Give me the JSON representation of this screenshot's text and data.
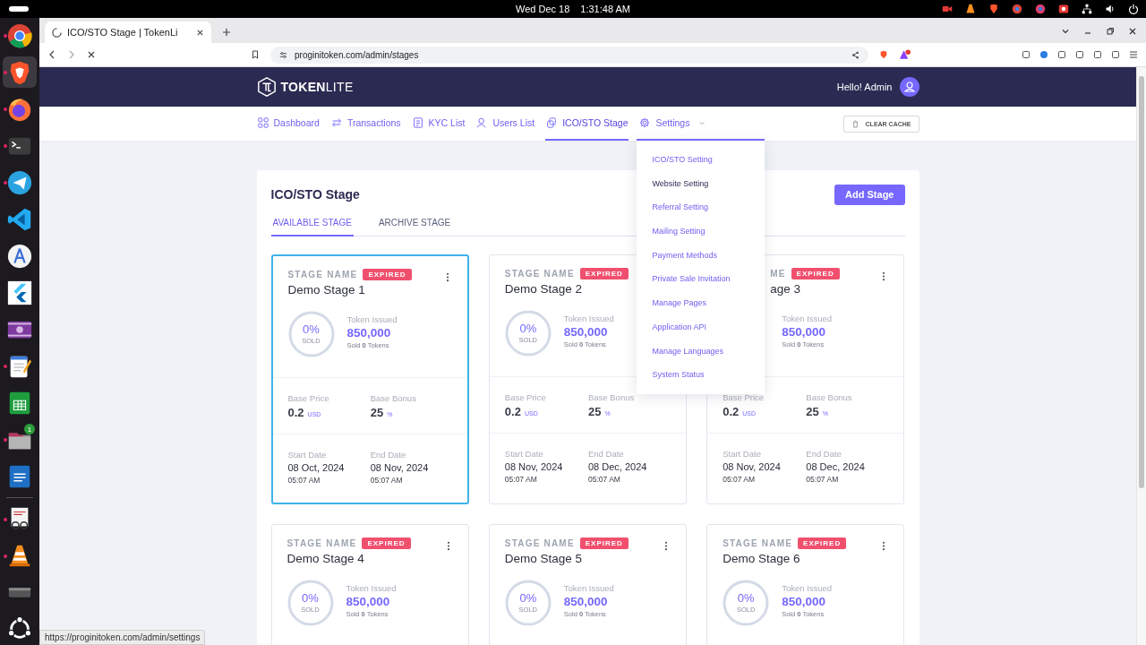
{
  "system_bar": {
    "date": "Wed Dec 18",
    "time": "1:31:48 AM"
  },
  "dock": [
    {
      "kind": "globe",
      "running": true,
      "selected": false
    },
    {
      "kind": "lion",
      "running": true,
      "selected": true
    },
    {
      "kind": "fox",
      "running": true,
      "selected": false
    },
    {
      "kind": "terminal",
      "running": true,
      "selected": false
    },
    {
      "kind": "plane",
      "running": true,
      "selected": false
    },
    {
      "kind": "code",
      "running": false,
      "selected": false
    },
    {
      "kind": "compass",
      "running": false,
      "selected": false
    },
    {
      "kind": "wing",
      "running": false,
      "selected": false
    },
    {
      "kind": "film",
      "running": false,
      "selected": false
    },
    {
      "kind": "notepad",
      "running": true,
      "selected": false
    },
    {
      "kind": "sheet",
      "running": false,
      "selected": false
    },
    {
      "kind": "folder",
      "running": true,
      "selected": false,
      "badge": "1"
    },
    {
      "kind": "doc",
      "running": false,
      "selected": false
    },
    {
      "kind": "reader",
      "running": true,
      "selected": false
    },
    {
      "kind": "cone",
      "running": true,
      "selected": false
    },
    {
      "kind": "drive",
      "running": false,
      "selected": false
    },
    {
      "kind": "spiral",
      "running": false,
      "selected": false
    }
  ],
  "browser": {
    "tabs": [
      {
        "title": "ICO/STO Stage | TokenLi",
        "selected": true,
        "loading": true
      }
    ],
    "address": "proginitoken.com/admin/stages",
    "status_url": "https://proginitoken.com/admin/settings"
  },
  "header": {
    "logo": "**TOKEN**LITE",
    "greeting": "Hello! Admin"
  },
  "nav": [
    {
      "label": "Dashboard",
      "selected": false
    },
    {
      "label": "Transactions",
      "selected": false
    },
    {
      "label": "KYC List",
      "selected": false
    },
    {
      "label": "Users List",
      "selected": false
    },
    {
      "label": "ICO/STO Stage",
      "selected": true
    },
    {
      "label": "Settings",
      "selected": false,
      "expanded": true,
      "menu": [
        {
          "label": "ICO/STO Setting",
          "hovered": false
        },
        {
          "label": "Website Setting",
          "hovered": true
        },
        {
          "label": "Referral Setting",
          "hovered": false
        },
        {
          "label": "Mailing Setting",
          "hovered": false
        },
        {
          "label": "Payment Methods",
          "hovered": false
        },
        {
          "label": "Private Sale Invitation",
          "hovered": false
        },
        {
          "label": "Manage Pages",
          "hovered": false
        },
        {
          "label": "Application API",
          "hovered": false
        },
        {
          "label": "Manage Languages",
          "hovered": false
        },
        {
          "label": "System Status",
          "hovered": false
        }
      ]
    }
  ],
  "clear_cache": "CLEAR CACHE",
  "panel": {
    "title": "ICO/STO Stage",
    "add_button": "Add Stage",
    "tabs": [
      {
        "label": "AVAILABLE STAGE",
        "selected": true
      },
      {
        "label": "ARCHIVE STAGE",
        "selected": false
      }
    ],
    "cards": [
      {
        "label": "STAGE NAME",
        "status": "EXPIRED",
        "name": "Demo Stage 1",
        "selected": true,
        "menu": true,
        "percent": "0%",
        "sold_label": "SOLD",
        "issued_label": "Token Issued",
        "issued": "850,000",
        "sold_tokens": "Sold **0** Tokens",
        "price_label": "Base Price",
        "price": "0.2",
        "price_unit": "USD",
        "bonus_label": "Base Bonus",
        "bonus": "25",
        "bonus_unit": "%",
        "start_label": "Start Date",
        "start_date": "08 Oct, 2024",
        "start_time": "05:07 AM",
        "end_label": "End Date",
        "end_date": "08 Nov, 2024",
        "end_time": "05:07 AM"
      },
      {
        "label": "STAGE NAME",
        "status": "EXPIRED",
        "name": "Demo Stage 2",
        "selected": false,
        "percent": "0%",
        "sold_label": "SOLD",
        "issued_label": "Token Issued",
        "issued": "850,000",
        "sold_tokens": "Sold **0** Tokens",
        "price_label": "Base Price",
        "price": "0.2",
        "price_unit": "USD",
        "bonus_label": "Base Bonus",
        "bonus": "25",
        "bonus_unit": "%",
        "start_label": "Start Date",
        "start_date": "08 Nov, 2024",
        "start_time": "05:07 AM",
        "end_label": "End Date",
        "end_date": "08 Dec, 2024",
        "end_time": "05:07 AM"
      },
      {
        "label": "ME",
        "covered": true,
        "status": "EXPIRED",
        "name": "age 3",
        "selected": false,
        "menu": true,
        "issued_label": "Token Issued",
        "issued": "850,000",
        "sold_tokens": "Sold **0** Tokens",
        "price_label": "Base Price",
        "price": "0.2",
        "price_unit": "USD",
        "bonus_label": "Base Bonus",
        "bonus": "25",
        "bonus_unit": "%",
        "start_label": "Start Date",
        "start_date": "08 Nov, 2024",
        "start_time": "05:07 AM",
        "end_label": "End Date",
        "end_date": "08 Dec, 2024",
        "end_time": "05:07 AM"
      },
      {
        "label": "STAGE NAME",
        "status": "EXPIRED",
        "name": "Demo Stage 4",
        "selected": false,
        "menu": true,
        "percent": "0%",
        "sold_label": "SOLD",
        "issued_label": "Token Issued",
        "issued": "850,000",
        "sold_tokens": "Sold **0** Tokens"
      },
      {
        "label": "STAGE NAME",
        "status": "EXPIRED",
        "name": "Demo Stage 5",
        "selected": false,
        "menu": true,
        "percent": "0%",
        "sold_label": "SOLD",
        "issued_label": "Token Issued",
        "issued": "850,000",
        "sold_tokens": "Sold **0** Tokens"
      },
      {
        "label": "STAGE NAME",
        "status": "EXPIRED",
        "name": "Demo Stage 6",
        "selected": false,
        "menu": true,
        "percent": "0%",
        "sold_label": "SOLD",
        "issued_label": "Token Issued",
        "issued": "850,000",
        "sold_tokens": "Sold **0** Tokens"
      }
    ]
  }
}
